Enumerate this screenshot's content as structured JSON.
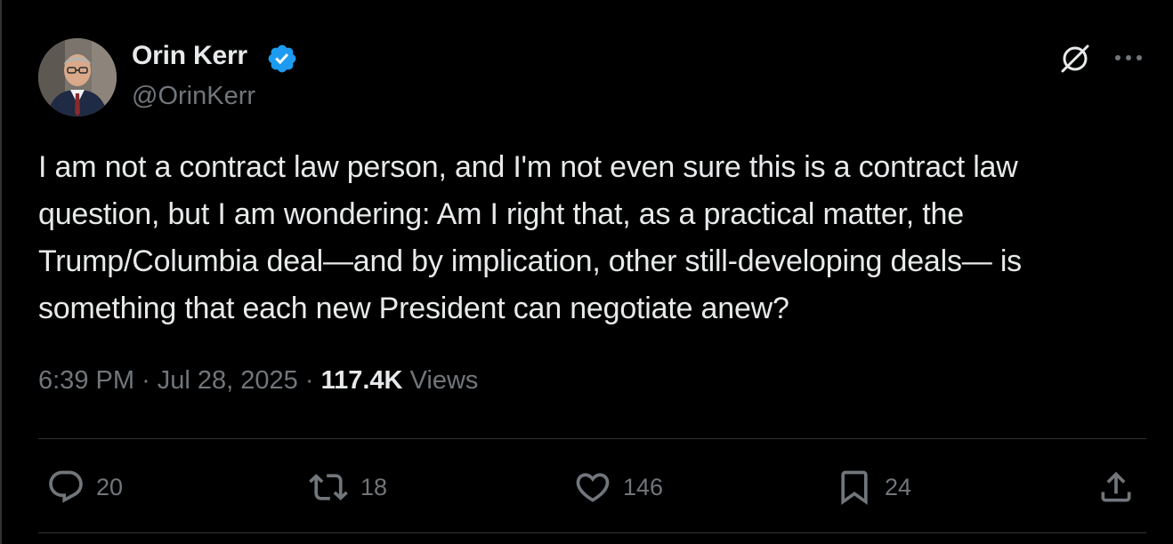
{
  "author": {
    "name": "Orin Kerr",
    "handle": "@OrinKerr",
    "verified": true
  },
  "tweet": {
    "text": "I am not a contract law person, and I'm not even sure this is a contract law question, but I am wondering: Am I right that, as a practical matter, the Trump/Columbia deal—and by implication, other still-developing deals— is something that each new President can negotiate anew?",
    "time": "6:39 PM",
    "date": "Jul 28, 2025",
    "views_count": "117.4K",
    "views_label": "Views"
  },
  "actions": {
    "replies": "20",
    "reposts": "18",
    "likes": "146",
    "bookmarks": "24"
  },
  "icons": {
    "verified": "verified-badge-icon",
    "grok": "grok-icon",
    "more": "more-horizontal-icon",
    "reply": "reply-icon",
    "repost": "repost-icon",
    "like": "heart-icon",
    "bookmark": "bookmark-icon",
    "share": "share-icon"
  },
  "colors": {
    "background": "#000000",
    "text_primary": "#e7e9ea",
    "text_secondary": "#71767b",
    "divider": "#2f3336",
    "verified_blue": "#1d9bf0"
  }
}
